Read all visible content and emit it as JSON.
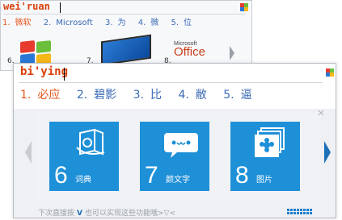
{
  "back_window": {
    "pinyin": "wei'ruan",
    "candidates": [
      {
        "index": "1.",
        "text": "微软"
      },
      {
        "index": "2.",
        "text": "Microsoft"
      },
      {
        "index": "3.",
        "text": "为"
      },
      {
        "index": "4.",
        "text": "微"
      },
      {
        "index": "5.",
        "text": "位"
      }
    ],
    "thumbnails": [
      {
        "num": "6.",
        "icon": "windows-logo"
      },
      {
        "num": "7.",
        "icon": "surface-tablet"
      },
      {
        "num": "8.",
        "icon": "office-logo",
        "brand_small": "Microsoft",
        "brand_big": "Office"
      }
    ]
  },
  "front_window": {
    "pinyin": "bi'ying",
    "candidates": [
      {
        "index": "1.",
        "text": "必应"
      },
      {
        "index": "2.",
        "text": "碧影"
      },
      {
        "index": "3.",
        "text": "比"
      },
      {
        "index": "4.",
        "text": "敝"
      },
      {
        "index": "5.",
        "text": "逼"
      }
    ],
    "close_glyph": "✕",
    "tiles": [
      {
        "num": "6",
        "label": "词典",
        "icon": "dictionary-icon"
      },
      {
        "num": "7",
        "label": "颜文字",
        "icon": "emoticon-icon"
      },
      {
        "num": "8",
        "label": "图片",
        "icon": "picture-icon"
      }
    ],
    "footer": {
      "text_before": "下次直接按",
      "key": "V",
      "text_after": "也可以实现这些功能哦>▽<"
    }
  },
  "colors": {
    "tile_blue": "#1e90d8",
    "pinyin_orange": "#d9400a",
    "first_candidate": "#e4571d",
    "candidate_blue": "#3a6ab6",
    "logo_red": "#e63b2e",
    "logo_green": "#6bbf3a",
    "logo_blue": "#2a78d6",
    "logo_yellow": "#f6b818"
  }
}
